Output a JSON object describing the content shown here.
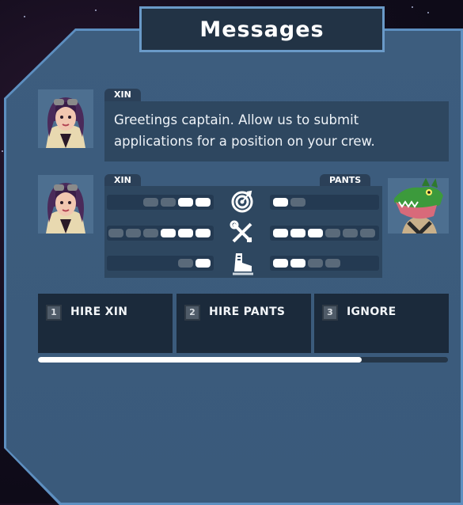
{
  "title": "Messages",
  "message": {
    "speaker": "XIN",
    "text_line1": "Greetings captain. Allow us to submit",
    "text_line2": "applications for a position on your crew."
  },
  "comparison": {
    "left_name": "XIN",
    "right_name": "PANTS",
    "stats": [
      {
        "icon": "target-icon",
        "left": {
          "filled": 2,
          "total": 4
        },
        "right": {
          "filled": 1,
          "total": 2
        }
      },
      {
        "icon": "wrench-screwdriver-icon",
        "left": {
          "filled": 3,
          "total": 6
        },
        "right": {
          "filled": 3,
          "total": 6
        }
      },
      {
        "icon": "boot-icon",
        "left": {
          "filled": 1,
          "total": 2
        },
        "right": {
          "filled": 2,
          "total": 4
        }
      }
    ]
  },
  "choices": [
    {
      "num": "1",
      "label": "HIRE XIN"
    },
    {
      "num": "2",
      "label": "HIRE PANTS"
    },
    {
      "num": "3",
      "label": "IGNORE"
    }
  ],
  "timer": {
    "progress": 0.79
  },
  "colors": {
    "panel": "#3b5b7c",
    "panel_border": "#5d8fc0",
    "box": "#2e4760",
    "choice_bg": "#1b2a3b",
    "pip_on": "#ffffff",
    "pip_off": "#5a6a7a"
  }
}
